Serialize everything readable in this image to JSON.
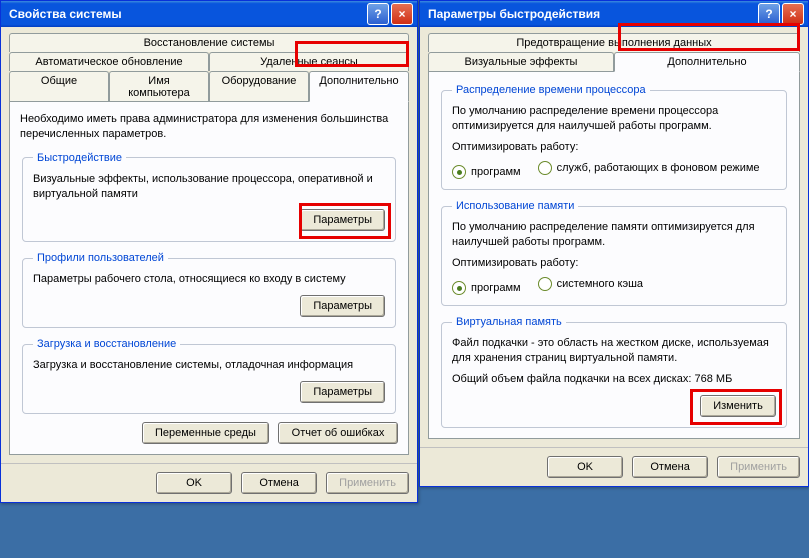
{
  "win1": {
    "title": "Свойства системы",
    "tabs": {
      "restore": "Восстановление системы",
      "autoupd": "Автоматическое обновление",
      "remote": "Удаленные сеансы",
      "general": "Общие",
      "compname": "Имя компьютера",
      "hardware": "Оборудование",
      "advanced": "Дополнительно"
    },
    "intro": "Необходимо иметь права администратора для изменения большинства перечисленных параметров.",
    "perf": {
      "legend": "Быстродействие",
      "text": "Визуальные эффекты, использование процессора, оперативной и виртуальной памяти",
      "btn": "Параметры"
    },
    "profiles": {
      "legend": "Профили пользователей",
      "text": "Параметры рабочего стола, относящиеся ко входу в систему",
      "btn": "Параметры"
    },
    "startup": {
      "legend": "Загрузка и восстановление",
      "text": "Загрузка и восстановление системы, отладочная информация",
      "btn": "Параметры"
    },
    "envbtn": "Переменные среды",
    "errbtn": "Отчет об ошибках",
    "ok": "OK",
    "cancel": "Отмена",
    "apply": "Применить"
  },
  "win2": {
    "title": "Параметры быстродействия",
    "tabs": {
      "dep": "Предотвращение выполнения данных",
      "visual": "Визуальные эффекты",
      "advanced": "Дополнительно"
    },
    "cpu": {
      "legend": "Распределение времени процессора",
      "text": "По умолчанию распределение времени процессора оптимизируется для наилучшей работы программ.",
      "optlabel": "Оптимизировать работу:",
      "r1": "программ",
      "r2": "служб, работающих в фоновом режиме"
    },
    "mem": {
      "legend": "Использование памяти",
      "text": "По умолчанию распределение памяти оптимизируется для наилучшей работы программ.",
      "optlabel": "Оптимизировать работу:",
      "r1": "программ",
      "r2": "системного кэша"
    },
    "vm": {
      "legend": "Виртуальная память",
      "text": "Файл подкачки - это область на жестком диске, используемая для хранения страниц виртуальной памяти.",
      "total": "Общий объем файла подкачки на всех дисках:  768 МБ",
      "btn": "Изменить"
    },
    "ok": "OK",
    "cancel": "Отмена",
    "apply": "Применить"
  }
}
